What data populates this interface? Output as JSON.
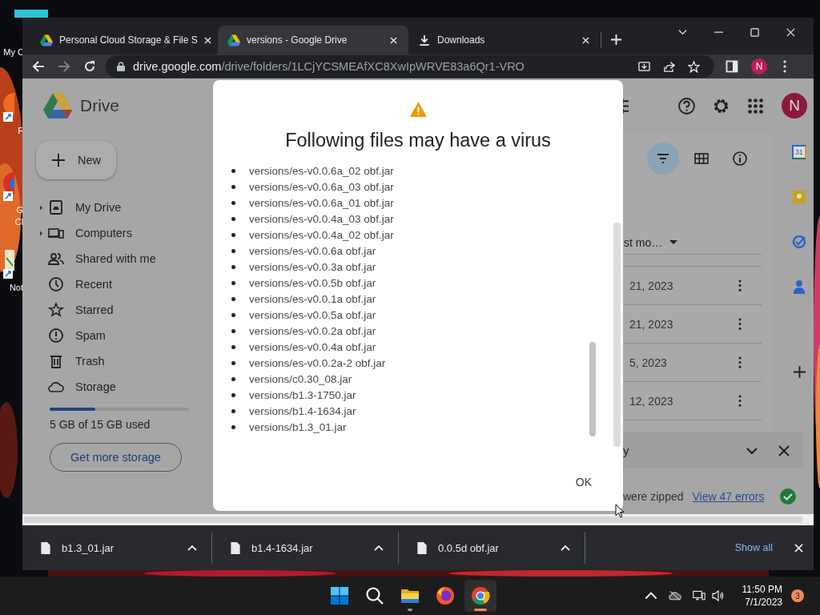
{
  "desktop_icons": [
    {
      "kind": "computer",
      "lines": [
        "My C"
      ]
    },
    {
      "kind": "firefox",
      "lines": [
        "F"
      ]
    },
    {
      "kind": "chrome",
      "lines": [
        "G",
        "Cl"
      ]
    },
    {
      "kind": "notepad",
      "lines": [
        "Not"
      ]
    }
  ],
  "browser": {
    "tabs": [
      {
        "title": "Personal Cloud Storage & File S",
        "kind": "drive",
        "selected": false
      },
      {
        "title": "versions - Google Drive",
        "kind": "drive",
        "selected": true
      },
      {
        "title": "Downloads",
        "kind": "download",
        "selected": false
      }
    ],
    "address": {
      "host": "drive.google.com",
      "path": "/drive/folders/1LCjYCSMEAfXC8XwIpWRVE83a6Qr1-VRO"
    },
    "profile": "N"
  },
  "drive": {
    "brand": "Drive",
    "new_label": "New",
    "nav": [
      {
        "label": "My Drive",
        "kind": "drive",
        "expandable": true
      },
      {
        "label": "Computers",
        "kind": "computers",
        "expandable": true
      },
      {
        "label": "Shared with me",
        "kind": "shared",
        "expandable": false
      },
      {
        "label": "Recent",
        "kind": "recent",
        "expandable": false
      },
      {
        "label": "Starred",
        "kind": "starred",
        "expandable": false
      },
      {
        "label": "Spam",
        "kind": "spam",
        "expandable": false
      },
      {
        "label": "Trash",
        "kind": "trash",
        "expandable": false
      },
      {
        "label": "Storage",
        "kind": "storage",
        "expandable": false
      }
    ],
    "storage": {
      "level": 0.33,
      "usage": "5 GB of 15 GB used",
      "upgrade": "Get more storage"
    },
    "account": "N",
    "view_buttons": [
      {
        "kind": "filter",
        "selected": true
      },
      {
        "kind": "grid",
        "selected": false
      },
      {
        "kind": "info",
        "selected": false
      }
    ],
    "sort_column": "st mo…",
    "rows": [
      {
        "modified": "21, 2023"
      },
      {
        "modified": "21, 2023"
      },
      {
        "modified": "5, 2023"
      },
      {
        "modified": "12, 2023"
      }
    ],
    "upload_panel": {
      "title": "y",
      "message": "were zipped",
      "link": "View 47 errors"
    },
    "side_apps": [
      {
        "kind": "calendar",
        "label": "31"
      },
      {
        "kind": "keep"
      },
      {
        "kind": "tasks"
      },
      {
        "kind": "contacts"
      }
    ]
  },
  "dialog": {
    "title": "Following files may have a virus",
    "files": [
      "versions/es-v0.0.6a_02 obf.jar",
      "versions/es-v0.0.6a_03 obf.jar",
      "versions/es-v0.0.6a_01 obf.jar",
      "versions/es-v0.0.4a_03 obf.jar",
      "versions/es-v0.0.4a_02 obf.jar",
      "versions/es-v0.0.6a obf.jar",
      "versions/es-v0.0.3a obf.jar",
      "versions/es-v0.0.5b obf.jar",
      "versions/es-v0.0.1a obf.jar",
      "versions/es-v0.0.5a obf.jar",
      "versions/es-v0.0.2a obf.jar",
      "versions/es-v0.0.4a obf.jar",
      "versions/es-v0.0.2a-2 obf.jar",
      "versions/c0.30_08.jar",
      "versions/b1.3-1750.jar",
      "versions/b1.4-1634.jar",
      "versions/b1.3_01.jar"
    ],
    "button": "OK"
  },
  "downloads": {
    "files": [
      "b1.3_01.jar",
      "b1.4-1634.jar",
      "0.0.5d obf.jar"
    ],
    "show_all": "Show all"
  },
  "taskbar": {
    "apps": [
      {
        "kind": "start",
        "selected": false,
        "running": false
      },
      {
        "kind": "search",
        "selected": false,
        "running": false
      },
      {
        "kind": "files",
        "selected": false,
        "running": true
      },
      {
        "kind": "firefox",
        "selected": false,
        "running": false
      },
      {
        "kind": "chrome",
        "selected": true,
        "running": true
      }
    ],
    "time": "11:50 PM",
    "date": "7/1/2023",
    "notifications": "3"
  }
}
